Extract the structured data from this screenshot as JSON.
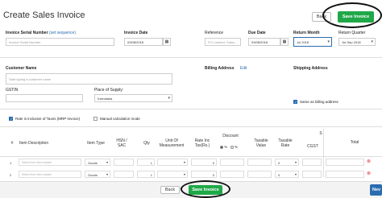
{
  "page": {
    "title": "Create Sales Invoice"
  },
  "header_buttons": {
    "back": "Back",
    "save": "Save Invoice"
  },
  "fields": {
    "serial_label": "Invoice Serial Number",
    "serial_link": "(set sequence)",
    "serial_placeholder": "Invoice Serial Number",
    "date_label": "Invoice Date",
    "date_value": "03/08/2018",
    "reference_label": "Reference",
    "reference_placeholder": "P.O number, Sales ...",
    "due_label": "Due Date",
    "due_value": "03/08/2018",
    "return_month_label": "Return Month",
    "return_month_value": "Jul 2018",
    "return_quarter_label": "Return Quarter",
    "return_quarter_value": "Jul-Sep 2018",
    "customer_label": "Customer Name",
    "customer_placeholder": "Start typing a customer name",
    "billing_label": "Billing Address",
    "billing_edit": "Edit",
    "shipping_label": "Shipping Address",
    "gstin_label": "GSTIN",
    "supply_label": "Place of Supply:",
    "supply_value": "Karnataka",
    "same_billing_label": "Same as billing address",
    "rate_inclusive_label": "Rate is inclusive of Taxes (MRP Invoice)",
    "manual_calc_label": "Manual calculation mode"
  },
  "table": {
    "headers": {
      "num": "#",
      "desc": "Item Description",
      "type": "Item Type",
      "hsn": "HSN / SAC",
      "qty": "Qty",
      "uom": "Unit Of Measurement",
      "rate": "Rate Inc Tax(Rs.)",
      "discount": "Discount",
      "disc_pct": "%",
      "disc_rs": "%",
      "taxable_value": "Taxable Value",
      "taxable_rate": "Taxable Rate",
      "cgst": "CGST",
      "s": "S",
      "total": "Total"
    },
    "rows": [
      {
        "num": "1",
        "desc": "Select from Item master",
        "type": "Goods",
        "qty": "1",
        "rate": "0",
        "taxable": "0"
      },
      {
        "num": "2",
        "desc": "Select from Item master",
        "type": "Goods",
        "qty": "1",
        "rate": "0",
        "taxable": "0"
      }
    ]
  },
  "footer_buttons": {
    "back": "Back",
    "save": "Save Invoice",
    "next": "Nev"
  },
  "colors": {
    "accent": "#20a848",
    "link": "#2b6cb0",
    "danger": "#dd3333"
  }
}
